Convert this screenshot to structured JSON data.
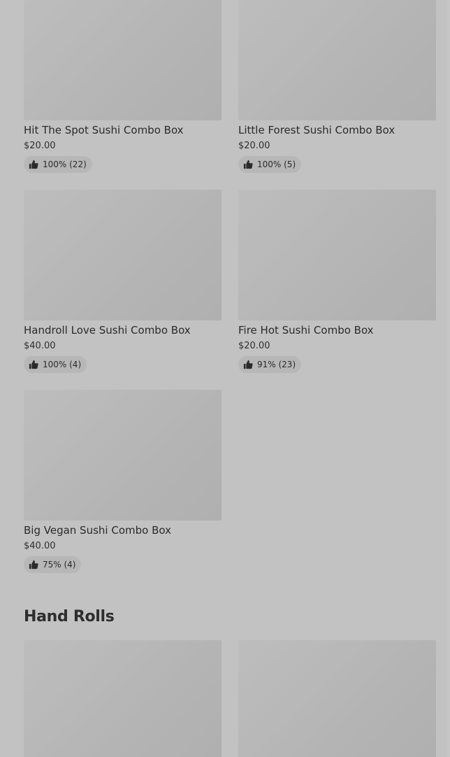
{
  "combo_items": [
    {
      "name": "Hit The Spot Sushi Combo Box",
      "price": "$20.00",
      "rating": "100% (22)"
    },
    {
      "name": "Little Forest Sushi Combo Box",
      "price": "$20.00",
      "rating": "100% (5)"
    },
    {
      "name": "Handroll Love Sushi Combo Box",
      "price": "$40.00",
      "rating": "100% (4)"
    },
    {
      "name": "Fire Hot Sushi Combo Box",
      "price": "$20.00",
      "rating": "91% (23)"
    },
    {
      "name": "Big Vegan Sushi Combo Box",
      "price": "$40.00",
      "rating": "75% (4)"
    }
  ],
  "hand_rolls": {
    "title": "Hand Rolls"
  },
  "icons": {
    "rating": "thumbs-up-icon"
  }
}
